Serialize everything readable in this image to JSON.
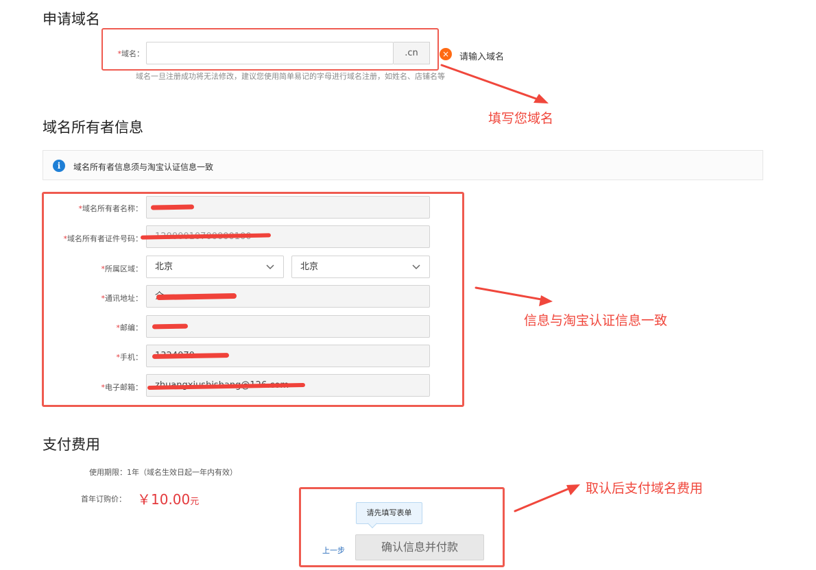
{
  "domain_section": {
    "title": "申请域名",
    "field_label": "域名",
    "label_required_mark": "*",
    "label_suffix": "：",
    "domain_value": "",
    "suffix": ".cn",
    "error_text": "请输入域名",
    "hint": "域名一旦注册成功将无法修改，建议您使用简单易记的字母进行域名注册，如姓名、店铺名等",
    "annotation": "填写您域名"
  },
  "owner_section": {
    "title": "域名所有者信息",
    "notice": "域名所有者信息须与淘宝认证信息一致",
    "annotation": "信息与淘宝认证信息一致",
    "fields": [
      {
        "label": "域名所有者名称",
        "value": ""
      },
      {
        "label": "域名所有者证件号码",
        "value": "12000010700000100"
      },
      {
        "label": "所属区域",
        "value_province": "北京",
        "value_city": "北京"
      },
      {
        "label": "通讯地址",
        "value": "介"
      },
      {
        "label": "邮编",
        "value": ""
      },
      {
        "label": "手机",
        "value": "1324070"
      },
      {
        "label": "电子邮箱",
        "value": "zhuangxiushishang@126.com"
      }
    ]
  },
  "payment_section": {
    "title": "支付费用",
    "period_label": "使用期限：",
    "period_value": "1年（域名生效日起一年内有效）",
    "price_label": "首年订购价：",
    "price_value": "￥10.00",
    "price_unit": "元",
    "tooltip": "请先填写表单",
    "prev_link": "上一步",
    "confirm_button": "确认信息并付款",
    "annotation": "取认后支付域名费用"
  },
  "colors": {
    "annotation_red": "#f0473c",
    "required_red": "#e4393c",
    "info_blue": "#1e7fd6",
    "error_orange": "#ff6a13"
  },
  "icons": {
    "info": "info-icon",
    "error": "close-icon",
    "chevron": "chevron-down-icon"
  }
}
